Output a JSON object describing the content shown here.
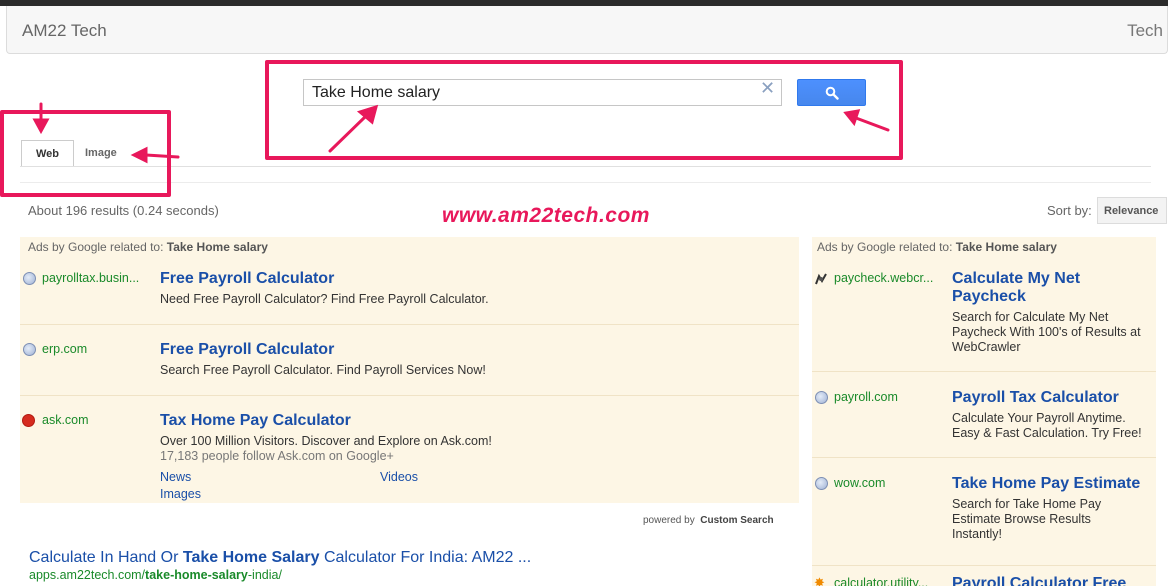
{
  "header": {
    "brand": "AM22 Tech",
    "right_text": "Tech"
  },
  "search": {
    "value": "Take Home salary",
    "clear_icon": "close-icon",
    "button_icon": "search-icon"
  },
  "tabs": [
    {
      "label": "Web",
      "active": true
    },
    {
      "label": "Image",
      "active": false
    }
  ],
  "results_stats": "About 196 results (0.24 seconds)",
  "watermark": "www.am22tech.com",
  "sort": {
    "label": "Sort by:",
    "value": "Relevance"
  },
  "ads_label": {
    "prefix": "Ads by Google related to:",
    "query": "Take Home salary"
  },
  "ads_main": [
    {
      "domain": "payrolltax.busin...",
      "icon": "globe-icon",
      "title": "Free Payroll Calculator",
      "desc": "Need Free Payroll Calculator? Find Free Payroll Calculator."
    },
    {
      "domain": "erp.com",
      "icon": "globe-icon",
      "title": "Free Payroll Calculator",
      "desc": "Search Free Payroll Calculator. Find Payroll Services Now!"
    },
    {
      "domain": "ask.com",
      "icon": "ask-logo-icon",
      "title": "Tax Home Pay Calculator",
      "desc": "Over 100 Million Visitors. Discover and Explore on Ask.com!",
      "follow": "17,183 people follow Ask.com on Google+",
      "sitelinks": [
        "News",
        "Videos",
        "Images"
      ]
    }
  ],
  "ads_side": [
    {
      "domain": "paycheck.webcr...",
      "icon": "paycheck-icon",
      "title_lines": [
        "Calculate My Net",
        "Paycheck"
      ],
      "desc_lines": [
        "Search for Calculate My Net",
        "Paycheck With 100's of Results at",
        "WebCrawler"
      ]
    },
    {
      "domain": "payroll.com",
      "icon": "globe-icon",
      "title_lines": [
        "Payroll Tax Calculator"
      ],
      "desc_lines": [
        "Calculate Your Payroll Anytime.",
        "Easy & Fast Calculation. Try Free!"
      ]
    },
    {
      "domain": "wow.com",
      "icon": "globe-icon",
      "title_lines": [
        "Take Home Pay Estimate"
      ],
      "desc_lines": [
        "Search for Take Home Pay",
        "Estimate Browse Results",
        "Instantly!"
      ]
    },
    {
      "domain": "calculator.utility...",
      "icon": "calculator-icon",
      "title_lines": [
        "Payroll Calculator Free"
      ]
    }
  ],
  "powered_by": {
    "prefix": "powered by",
    "name": "Custom Search"
  },
  "result": {
    "title_pre": "Calculate In Hand Or ",
    "title_bold": "Take Home Salary",
    "title_post": " Calculator For India: AM22 ...",
    "url_pre": "apps.am22tech.com/",
    "url_bold": "take-home-salary",
    "url_post": "-india/"
  },
  "colors": {
    "annotation": "#e8185b",
    "link": "#1a4fa8",
    "url": "#1a8a2a",
    "ad_background": "#fdf6e5",
    "button": "#4d90fe"
  }
}
